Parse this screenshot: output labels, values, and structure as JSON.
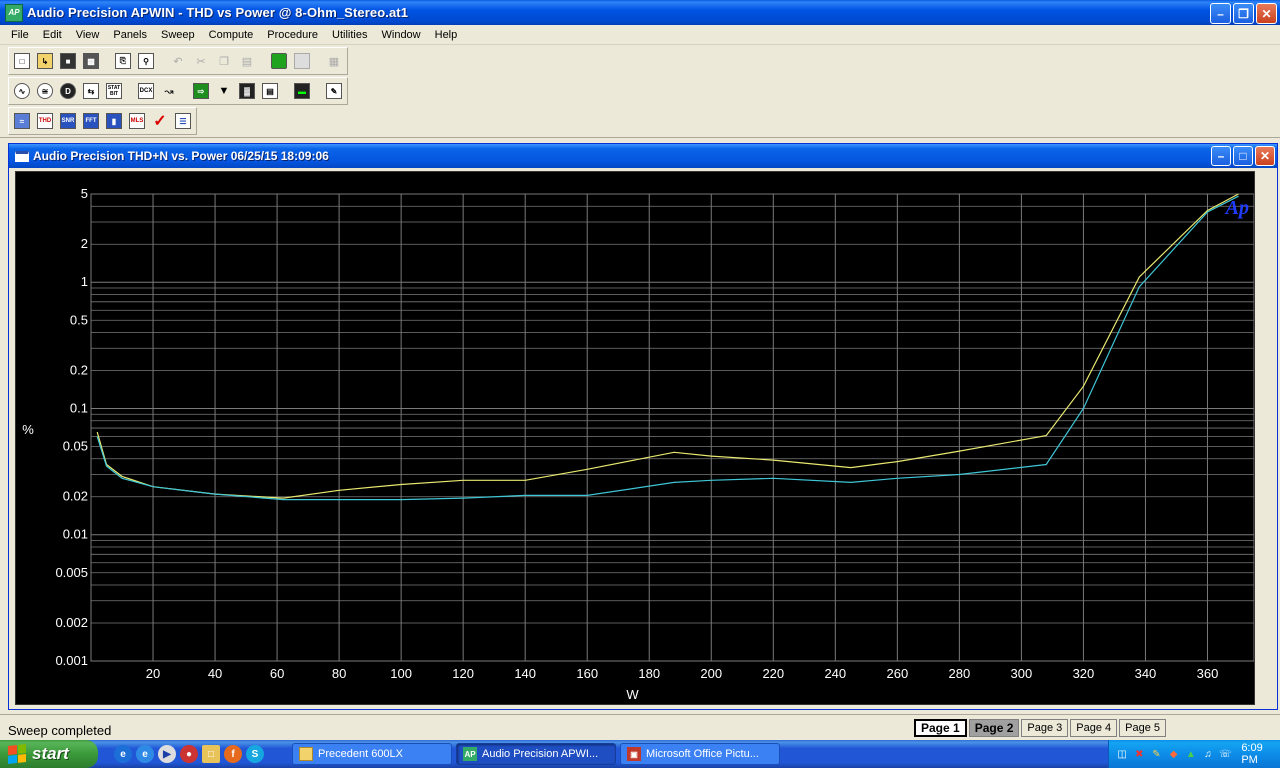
{
  "window": {
    "title": "Audio Precision APWIN - THD vs Power @ 8-Ohm_Stereo.at1",
    "app_icon": "AP"
  },
  "menu": [
    "File",
    "Edit",
    "View",
    "Panels",
    "Sweep",
    "Compute",
    "Procedure",
    "Utilities",
    "Window",
    "Help"
  ],
  "toolbar": {
    "row1": [
      "new-file-icon",
      "open-folder-icon",
      "save-icon",
      "save-all-icon",
      "print-icon",
      "print-preview-icon",
      "undo-icon",
      "cut-icon",
      "copy-icon",
      "paste-icon",
      "go-icon",
      "stop-icon",
      "grid-icon"
    ],
    "row2": [
      "generator-icon",
      "analyzer-icon",
      "dsp-icon",
      "swap-icon",
      "stat-bit-icon",
      "dcx-icon",
      "switcher-icon",
      "sweep-icon",
      "settling-icon",
      "bar-graph-icon",
      "panel-icon",
      "loudness-icon",
      "edit-icon"
    ],
    "row3_labels": {
      "thd": "THD",
      "snr": "SNR",
      "fft": "FFT",
      "mls": "MLS"
    },
    "row2_labels": {
      "stat": "STAT",
      "bit": "BIT",
      "dcx": "DCX"
    }
  },
  "graph_window": {
    "title": "Audio Precision  THD+N vs. Power  06/25/15 18:09:06",
    "logo": "Ap"
  },
  "chart_data": {
    "type": "line",
    "x": [
      2,
      5,
      10,
      20,
      40,
      62,
      80,
      100,
      120,
      140,
      160,
      188,
      200,
      220,
      245,
      260,
      280,
      308,
      320,
      338,
      360,
      370
    ],
    "series": [
      {
        "color": "#e8e870",
        "values": [
          0.065,
          0.036,
          0.029,
          0.024,
          0.021,
          0.0195,
          0.0225,
          0.025,
          0.027,
          0.027,
          0.033,
          0.045,
          0.042,
          0.039,
          0.034,
          0.038,
          0.046,
          0.061,
          0.15,
          1.1,
          3.7,
          5.0
        ]
      },
      {
        "color": "#3fc6d6",
        "values": [
          0.06,
          0.035,
          0.028,
          0.024,
          0.021,
          0.019,
          0.019,
          0.019,
          0.0195,
          0.0205,
          0.0205,
          0.026,
          0.027,
          0.028,
          0.026,
          0.028,
          0.03,
          0.036,
          0.1,
          0.92,
          3.6,
          4.8
        ]
      }
    ],
    "xlim": [
      0,
      375
    ],
    "ylim": [
      0.001,
      5
    ],
    "y_scale": "log",
    "xticks": [
      20,
      40,
      60,
      80,
      100,
      120,
      140,
      160,
      180,
      200,
      220,
      240,
      260,
      280,
      300,
      320,
      340,
      360
    ],
    "yticks": [
      {
        "v": 0.001,
        "label": "0.001"
      },
      {
        "v": 0.002,
        "label": "0.002"
      },
      {
        "v": 0.005,
        "label": "0.005"
      },
      {
        "v": 0.01,
        "label": "0.01"
      },
      {
        "v": 0.02,
        "label": "0.02"
      },
      {
        "v": 0.05,
        "label": "0.05"
      },
      {
        "v": 0.1,
        "label": "0.1"
      },
      {
        "v": 0.2,
        "label": "0.2"
      },
      {
        "v": 0.5,
        "label": "0.5"
      },
      {
        "v": 1,
        "label": "1"
      },
      {
        "v": 2,
        "label": "2"
      },
      {
        "v": 5,
        "label": "5"
      }
    ],
    "xlabel": "W",
    "ylabel": "%",
    "grid": true,
    "background": "#000000",
    "grid_color": "#7a7a7a",
    "text_color": "#ffffff"
  },
  "status": {
    "text": "Sweep completed",
    "pages": [
      "Page 1",
      "Page 2",
      "Page 3",
      "Page 4",
      "Page 5"
    ]
  },
  "taskbar": {
    "start": "start",
    "tasks": [
      {
        "label": "Precedent 600LX",
        "icon": "folder-icon"
      },
      {
        "label": "Audio Precision APWI...",
        "icon": "apwin-icon"
      },
      {
        "label": "Microsoft Office Pictu...",
        "icon": "picture-manager-icon"
      }
    ],
    "clock": "6:09 PM"
  }
}
